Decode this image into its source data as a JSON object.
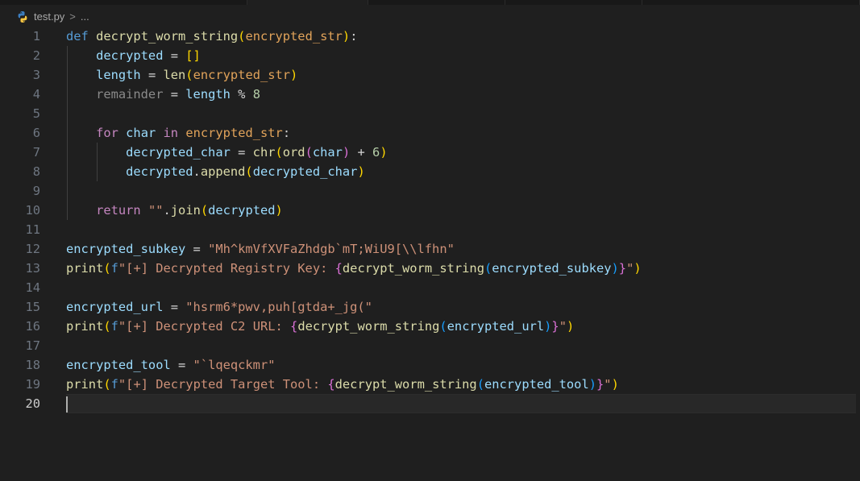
{
  "breadcrumb": {
    "file_name": "test.py",
    "separator": ">",
    "more": "...",
    "file_icon": "python-icon"
  },
  "editor": {
    "language": "python",
    "current_line": 20,
    "lines": [
      {
        "n": "1",
        "indent": 0,
        "tokens": [
          {
            "t": "def",
            "c": "kw2"
          },
          {
            "t": " ",
            "c": "op"
          },
          {
            "t": "decrypt_worm_string",
            "c": "fn"
          },
          {
            "t": "(",
            "c": "br1"
          },
          {
            "t": "encrypted_str",
            "c": "param"
          },
          {
            "t": ")",
            "c": "br1"
          },
          {
            "t": ":",
            "c": "pn"
          }
        ]
      },
      {
        "n": "2",
        "indent": 1,
        "tokens": [
          {
            "t": "decrypted",
            "c": "var"
          },
          {
            "t": " = ",
            "c": "op"
          },
          {
            "t": "[]",
            "c": "br1"
          }
        ]
      },
      {
        "n": "3",
        "indent": 1,
        "tokens": [
          {
            "t": "length",
            "c": "var"
          },
          {
            "t": " = ",
            "c": "op"
          },
          {
            "t": "len",
            "c": "fn"
          },
          {
            "t": "(",
            "c": "br1"
          },
          {
            "t": "encrypted_str",
            "c": "param"
          },
          {
            "t": ")",
            "c": "br1"
          }
        ]
      },
      {
        "n": "4",
        "indent": 1,
        "tokens": [
          {
            "t": "remainder",
            "c": "dim"
          },
          {
            "t": " = ",
            "c": "op"
          },
          {
            "t": "length",
            "c": "var"
          },
          {
            "t": " % ",
            "c": "op"
          },
          {
            "t": "8",
            "c": "num"
          }
        ]
      },
      {
        "n": "5",
        "indent": 1,
        "tokens": []
      },
      {
        "n": "6",
        "indent": 1,
        "tokens": [
          {
            "t": "for",
            "c": "kw"
          },
          {
            "t": " ",
            "c": "op"
          },
          {
            "t": "char",
            "c": "var"
          },
          {
            "t": " ",
            "c": "op"
          },
          {
            "t": "in",
            "c": "kw"
          },
          {
            "t": " ",
            "c": "op"
          },
          {
            "t": "encrypted_str",
            "c": "param"
          },
          {
            "t": ":",
            "c": "pn"
          }
        ]
      },
      {
        "n": "7",
        "indent": 2,
        "tokens": [
          {
            "t": "decrypted_char",
            "c": "var"
          },
          {
            "t": " = ",
            "c": "op"
          },
          {
            "t": "chr",
            "c": "fn"
          },
          {
            "t": "(",
            "c": "br1"
          },
          {
            "t": "ord",
            "c": "fn"
          },
          {
            "t": "(",
            "c": "br2"
          },
          {
            "t": "char",
            "c": "var"
          },
          {
            "t": ")",
            "c": "br2"
          },
          {
            "t": " + ",
            "c": "op"
          },
          {
            "t": "6",
            "c": "num"
          },
          {
            "t": ")",
            "c": "br1"
          }
        ]
      },
      {
        "n": "8",
        "indent": 2,
        "tokens": [
          {
            "t": "decrypted",
            "c": "var"
          },
          {
            "t": ".",
            "c": "op"
          },
          {
            "t": "append",
            "c": "fn"
          },
          {
            "t": "(",
            "c": "br1"
          },
          {
            "t": "decrypted_char",
            "c": "var"
          },
          {
            "t": ")",
            "c": "br1"
          }
        ]
      },
      {
        "n": "9",
        "indent": 1,
        "tokens": []
      },
      {
        "n": "10",
        "indent": 1,
        "tokens": [
          {
            "t": "return",
            "c": "kw"
          },
          {
            "t": " ",
            "c": "op"
          },
          {
            "t": "\"\"",
            "c": "str"
          },
          {
            "t": ".",
            "c": "op"
          },
          {
            "t": "join",
            "c": "fn"
          },
          {
            "t": "(",
            "c": "br1"
          },
          {
            "t": "decrypted",
            "c": "var"
          },
          {
            "t": ")",
            "c": "br1"
          }
        ]
      },
      {
        "n": "11",
        "indent": 0,
        "tokens": []
      },
      {
        "n": "12",
        "indent": 0,
        "tokens": [
          {
            "t": "encrypted_subkey",
            "c": "var"
          },
          {
            "t": " = ",
            "c": "op"
          },
          {
            "t": "\"Mh^kmVfXVFaZhdgb`mT;WiU9[\\\\lfhn\"",
            "c": "str"
          }
        ]
      },
      {
        "n": "13",
        "indent": 0,
        "tokens": [
          {
            "t": "print",
            "c": "fn"
          },
          {
            "t": "(",
            "c": "br1"
          },
          {
            "t": "f",
            "c": "fstr"
          },
          {
            "t": "\"[+] Decrypted Registry Key: ",
            "c": "str"
          },
          {
            "t": "{",
            "c": "br2"
          },
          {
            "t": "decrypt_worm_string",
            "c": "fn"
          },
          {
            "t": "(",
            "c": "br3"
          },
          {
            "t": "encrypted_subkey",
            "c": "var"
          },
          {
            "t": ")",
            "c": "br3"
          },
          {
            "t": "}",
            "c": "br2"
          },
          {
            "t": "\"",
            "c": "str"
          },
          {
            "t": ")",
            "c": "br1"
          }
        ]
      },
      {
        "n": "14",
        "indent": 0,
        "tokens": []
      },
      {
        "n": "15",
        "indent": 0,
        "tokens": [
          {
            "t": "encrypted_url",
            "c": "var"
          },
          {
            "t": " = ",
            "c": "op"
          },
          {
            "t": "\"hsrm6*pwv,puh[gtda+_jg(\"",
            "c": "str"
          }
        ]
      },
      {
        "n": "16",
        "indent": 0,
        "tokens": [
          {
            "t": "print",
            "c": "fn"
          },
          {
            "t": "(",
            "c": "br1"
          },
          {
            "t": "f",
            "c": "fstr"
          },
          {
            "t": "\"[+] Decrypted C2 URL: ",
            "c": "str"
          },
          {
            "t": "{",
            "c": "br2"
          },
          {
            "t": "decrypt_worm_string",
            "c": "fn"
          },
          {
            "t": "(",
            "c": "br3"
          },
          {
            "t": "encrypted_url",
            "c": "var"
          },
          {
            "t": ")",
            "c": "br3"
          },
          {
            "t": "}",
            "c": "br2"
          },
          {
            "t": "\"",
            "c": "str"
          },
          {
            "t": ")",
            "c": "br1"
          }
        ]
      },
      {
        "n": "17",
        "indent": 0,
        "tokens": []
      },
      {
        "n": "18",
        "indent": 0,
        "tokens": [
          {
            "t": "encrypted_tool",
            "c": "var"
          },
          {
            "t": " = ",
            "c": "op"
          },
          {
            "t": "\"`lqeqckmr\"",
            "c": "str"
          }
        ]
      },
      {
        "n": "19",
        "indent": 0,
        "tokens": [
          {
            "t": "print",
            "c": "fn"
          },
          {
            "t": "(",
            "c": "br1"
          },
          {
            "t": "f",
            "c": "fstr"
          },
          {
            "t": "\"[+] Decrypted Target Tool: ",
            "c": "str"
          },
          {
            "t": "{",
            "c": "br2"
          },
          {
            "t": "decrypt_worm_string",
            "c": "fn"
          },
          {
            "t": "(",
            "c": "br3"
          },
          {
            "t": "encrypted_tool",
            "c": "var"
          },
          {
            "t": ")",
            "c": "br3"
          },
          {
            "t": "}",
            "c": "br2"
          },
          {
            "t": "\"",
            "c": "str"
          },
          {
            "t": ")",
            "c": "br1"
          }
        ]
      },
      {
        "n": "20",
        "indent": 0,
        "tokens": []
      }
    ]
  }
}
